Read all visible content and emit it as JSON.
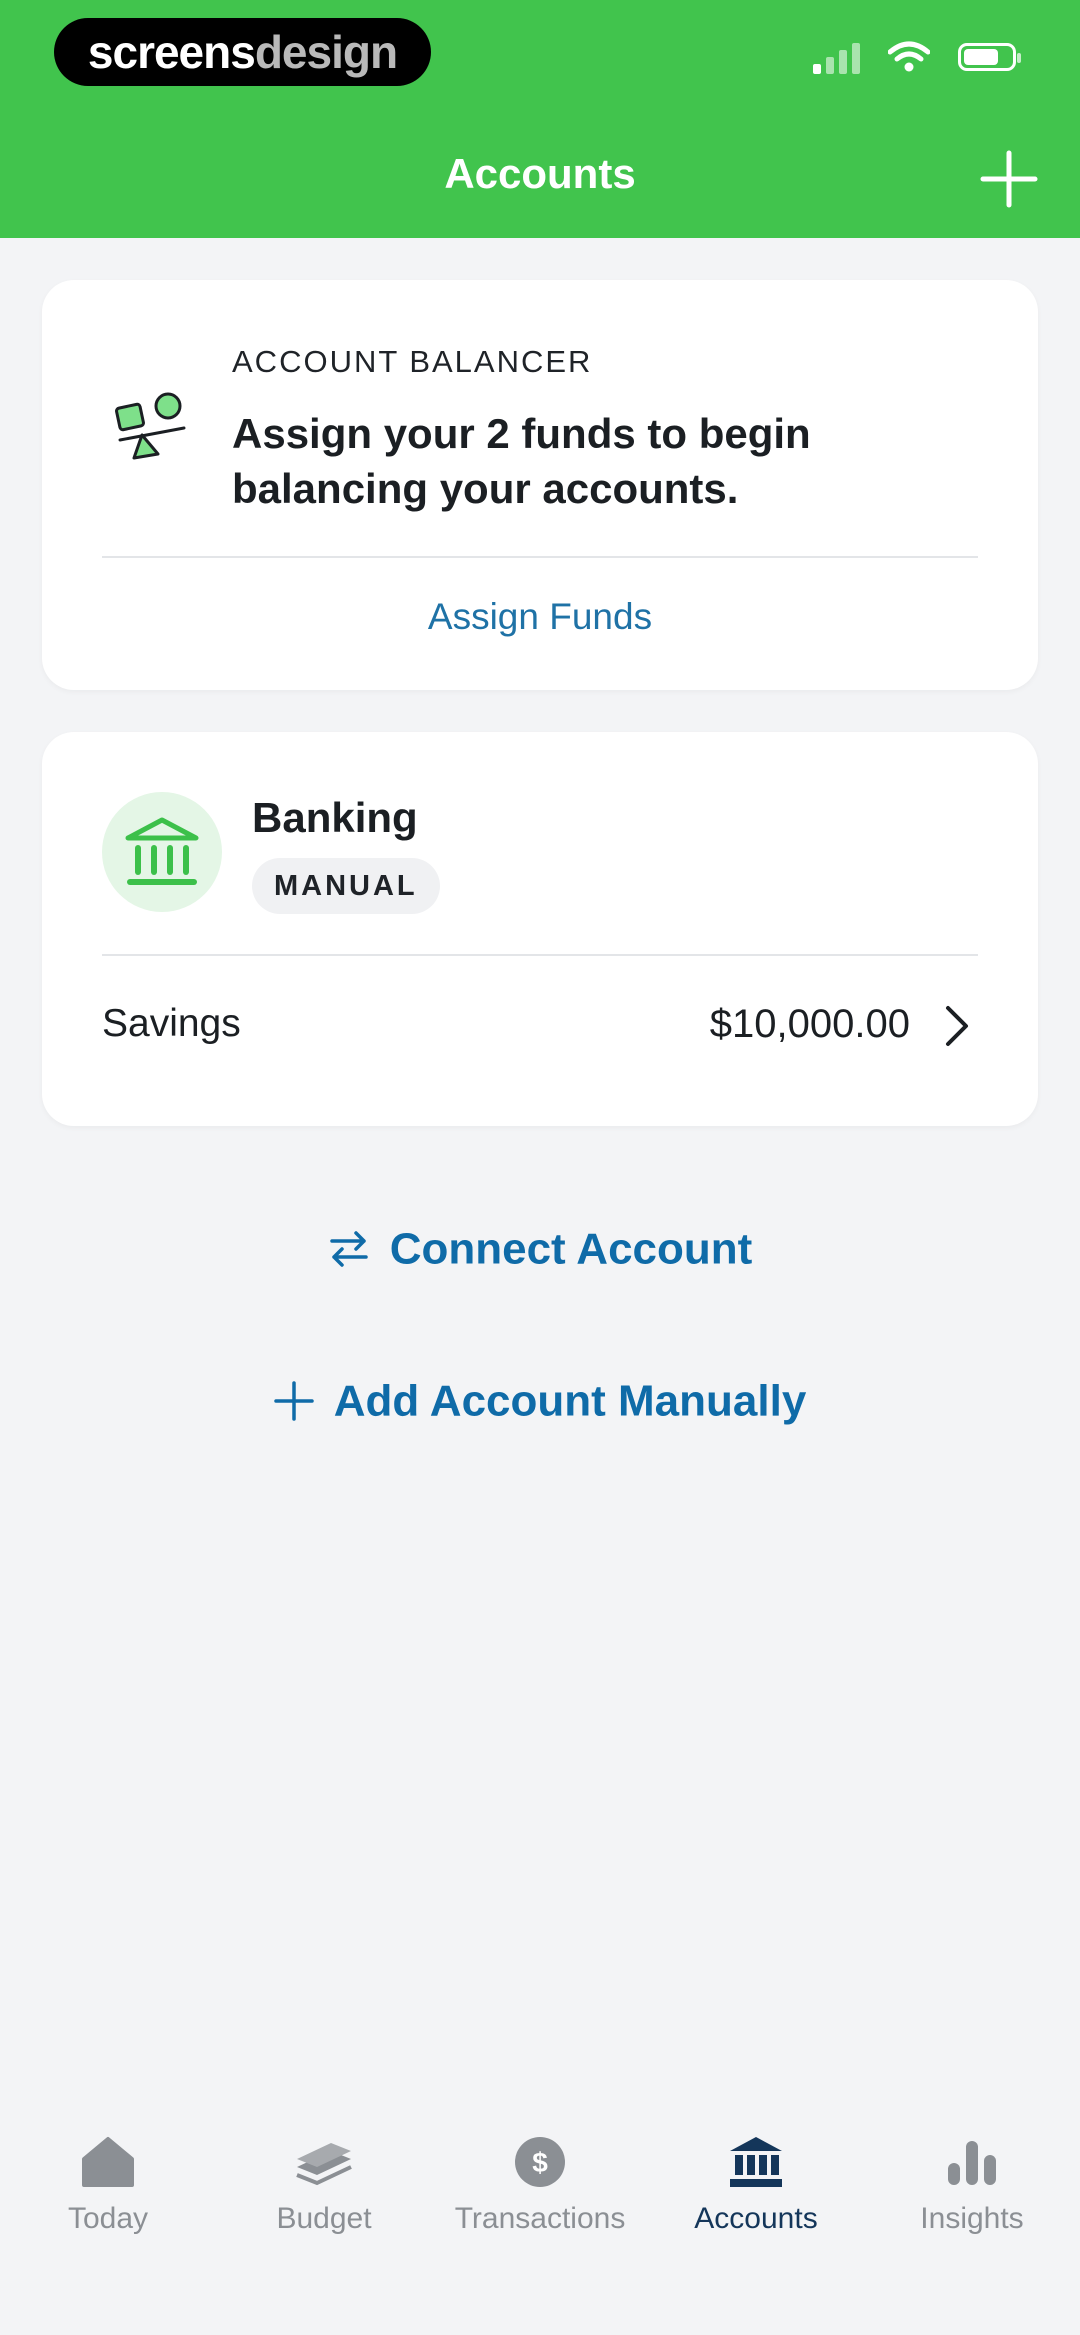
{
  "brand": {
    "part1": "screens",
    "part2": "design"
  },
  "header": {
    "title": "Accounts"
  },
  "balancer": {
    "eyebrow": "ACCOUNT BALANCER",
    "message": "Assign your 2 funds to begin balancing your accounts.",
    "action_label": "Assign Funds"
  },
  "banking": {
    "title": "Banking",
    "badge": "MANUAL",
    "accounts": [
      {
        "name": "Savings",
        "amount": "$10,000.00"
      }
    ]
  },
  "actions": {
    "connect_label": "Connect Account",
    "add_manual_label": "Add Account Manually"
  },
  "tabs": [
    {
      "label": "Today",
      "icon": "home-icon"
    },
    {
      "label": "Budget",
      "icon": "budget-icon"
    },
    {
      "label": "Transactions",
      "icon": "dollar-icon"
    },
    {
      "label": "Accounts",
      "icon": "bank-icon",
      "active": true
    },
    {
      "label": "Insights",
      "icon": "bar-chart-icon"
    }
  ],
  "colors": {
    "header_green": "#41c44d",
    "link_blue": "#0f6ba8",
    "tab_active": "#14365a",
    "tab_inactive": "#8b8f94"
  }
}
